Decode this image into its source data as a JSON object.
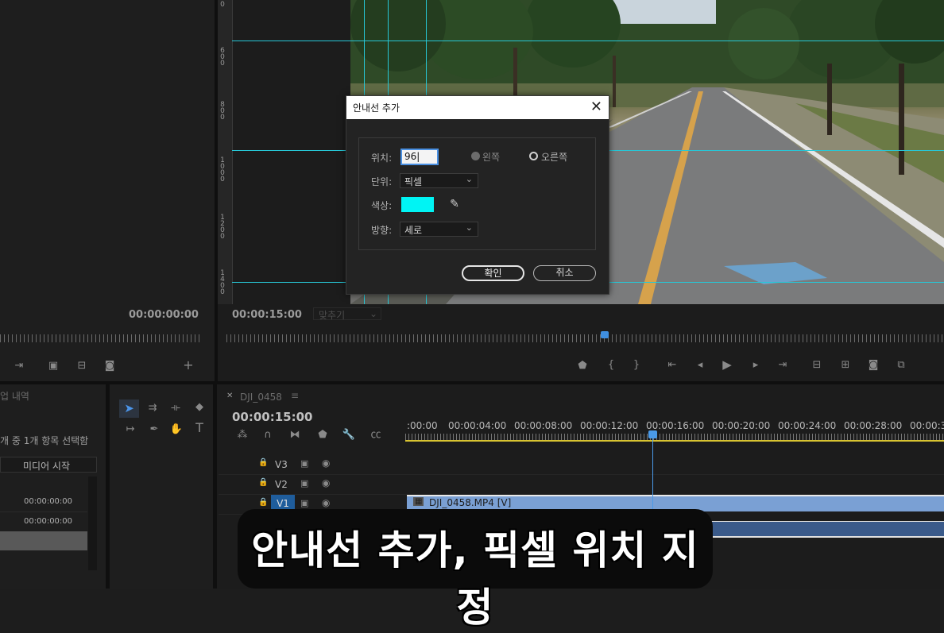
{
  "source_monitor": {
    "timecode": "00:00:00:00"
  },
  "program_monitor": {
    "timecode": "00:00:15:00",
    "fit_select": "맞추기",
    "ruler_labels": [
      "0",
      "6\n0\n0",
      "8\n0\n0",
      "1\n0\n0\n0",
      "1\n2\n0\n0",
      "1\n4\n0\n0"
    ]
  },
  "guide_dialog": {
    "title": "안내선 추가",
    "close_label": "✕",
    "position_label": "위치:",
    "position_value": "96",
    "direction_left": "왼쪽",
    "direction_right": "오른쪽",
    "unit_label": "단위:",
    "unit_value": "픽셀",
    "color_label": "색상:",
    "color_value": "#00f4f4",
    "orientation_label": "방향:",
    "orientation_value": "세로",
    "ok_label": "확인",
    "cancel_label": "취소"
  },
  "project_panel": {
    "tab_label": "업 내역",
    "selection_text": "개 중 1개 항목 선택함",
    "column_header": "미디어 시작",
    "rows": [
      "00:00:00:00",
      "00:00:00:00"
    ]
  },
  "timeline": {
    "sequence_name": "DJI_0458",
    "timecode": "00:00:15:00",
    "ruler_labels": [
      ":00:00",
      "00:00:04:00",
      "00:00:08:00",
      "00:00:12:00",
      "00:00:16:00",
      "00:00:20:00",
      "00:00:24:00",
      "00:00:28:00",
      "00:00:3"
    ],
    "tracks": [
      "V3",
      "V2",
      "V1"
    ],
    "clip_label": "DJI_0458.MP4 [V]"
  },
  "caption": "안내선 추가, 픽셀 위치 지정",
  "colors": {
    "guide": "#27c7d6",
    "accent_blue": "#2d8ceb",
    "playhead": "#4a9ae8",
    "clip": "#7aa0d4"
  }
}
